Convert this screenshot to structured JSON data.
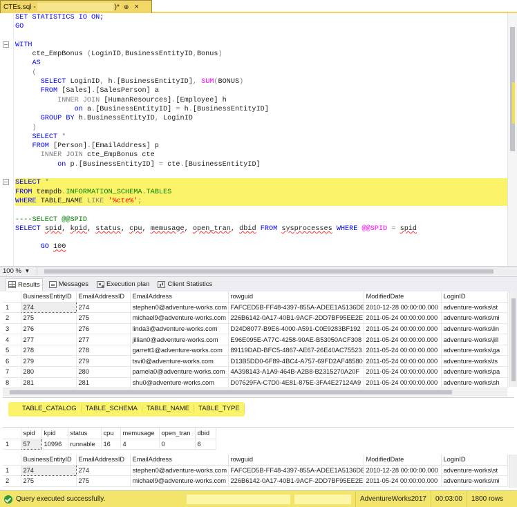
{
  "tab": {
    "title_prefix": "CTEs.sql - ",
    "title_suffix": ")*",
    "pin": "⊕",
    "close": "×"
  },
  "editor": {
    "lines": [
      [
        [
          "SET STATISTICS IO ON;",
          "kw"
        ]
      ],
      [
        [
          "GO",
          "kw"
        ]
      ],
      [
        [
          "",
          ""
        ]
      ],
      [
        [
          "WITH",
          "kw"
        ]
      ],
      [
        [
          "    cte_EmpBonus ",
          ""
        ],
        [
          "(",
          "gr"
        ],
        [
          "LoginID",
          ""
        ],
        [
          ",",
          "gr"
        ],
        [
          "BusinessEntityID",
          ""
        ],
        [
          ",",
          "gr"
        ],
        [
          "Bonus",
          ""
        ],
        [
          ")",
          "gr"
        ]
      ],
      [
        [
          "    ",
          ""
        ],
        [
          "AS",
          "kw"
        ]
      ],
      [
        [
          "    ",
          ""
        ],
        [
          "(",
          "gr"
        ]
      ],
      [
        [
          "      ",
          ""
        ],
        [
          "SELECT",
          "kw"
        ],
        [
          " LoginID",
          ""
        ],
        [
          ",",
          "gr"
        ],
        [
          " h",
          ""
        ],
        [
          ".",
          "gr"
        ],
        [
          "[BusinessEntityID]",
          ""
        ],
        [
          ",",
          "gr"
        ],
        [
          " ",
          ""
        ],
        [
          "SUM",
          "pk"
        ],
        [
          "(",
          "gr"
        ],
        [
          "BONUS",
          ""
        ],
        [
          ")",
          "gr"
        ]
      ],
      [
        [
          "      ",
          ""
        ],
        [
          "FROM",
          "kw"
        ],
        [
          " [Sales]",
          ""
        ],
        [
          ".",
          "gr"
        ],
        [
          "[SalesPerson] a",
          ""
        ]
      ],
      [
        [
          "          ",
          ""
        ],
        [
          "INNER JOIN",
          "gr"
        ],
        [
          " [HumanResources]",
          ""
        ],
        [
          ".",
          "gr"
        ],
        [
          "[Employee] h",
          ""
        ]
      ],
      [
        [
          "              ",
          ""
        ],
        [
          "on",
          "kw"
        ],
        [
          " a",
          ""
        ],
        [
          ".",
          "gr"
        ],
        [
          "[BusinessEntityID] ",
          ""
        ],
        [
          "=",
          "gr"
        ],
        [
          " h",
          ""
        ],
        [
          ".",
          "gr"
        ],
        [
          "[BusinessEntityID]",
          ""
        ]
      ],
      [
        [
          "      ",
          ""
        ],
        [
          "GROUP BY",
          "kw"
        ],
        [
          " h",
          ""
        ],
        [
          ".",
          "gr"
        ],
        [
          "BusinessEntityID",
          ""
        ],
        [
          ",",
          "gr"
        ],
        [
          " LoginID",
          ""
        ]
      ],
      [
        [
          "    ",
          ""
        ],
        [
          ")",
          "gr"
        ]
      ],
      [
        [
          "    ",
          ""
        ],
        [
          "SELECT",
          "kw"
        ],
        [
          " ",
          ""
        ],
        [
          "*",
          "gr"
        ]
      ],
      [
        [
          "    ",
          ""
        ],
        [
          "FROM",
          "kw"
        ],
        [
          " [Person]",
          ""
        ],
        [
          ".",
          "gr"
        ],
        [
          "[EmailAddress] p",
          ""
        ]
      ],
      [
        [
          "      ",
          ""
        ],
        [
          "INNER JOIN",
          "gr"
        ],
        [
          " cte_EmpBonus cte",
          ""
        ]
      ],
      [
        [
          "          ",
          ""
        ],
        [
          "on",
          "kw"
        ],
        [
          " p",
          ""
        ],
        [
          ".",
          "gr"
        ],
        [
          "[BusinessEntityID] ",
          ""
        ],
        [
          "=",
          "gr"
        ],
        [
          " cte",
          ""
        ],
        [
          ".",
          "gr"
        ],
        [
          "[BusinessEntityID]",
          ""
        ]
      ],
      [
        [
          "",
          ""
        ]
      ],
      [
        [
          "SELECT",
          "kw"
        ],
        [
          " ",
          ""
        ],
        [
          "*",
          "gr"
        ]
      ],
      [
        [
          "FROM",
          "kw"
        ],
        [
          " tempdb",
          ""
        ],
        [
          ".",
          "gr"
        ],
        [
          "INFORMATION_SCHEMA",
          "gn"
        ],
        [
          ".",
          "gr"
        ],
        [
          "TABLES",
          "gn"
        ]
      ],
      [
        [
          "WHERE",
          "kw"
        ],
        [
          " TABLE_NAME ",
          ""
        ],
        [
          "LIKE",
          "gr"
        ],
        [
          " ",
          ""
        ],
        [
          "'%cte%'",
          "st"
        ],
        [
          ";",
          "gr"
        ]
      ],
      [
        [
          "",
          ""
        ]
      ],
      [
        [
          "----SELECT @@SPID",
          "gn"
        ]
      ],
      [
        [
          "SELECT",
          "kw"
        ],
        [
          " ",
          ""
        ],
        [
          "spid",
          "wv"
        ],
        [
          ", ",
          ""
        ],
        [
          "kpid",
          "wv"
        ],
        [
          ", ",
          ""
        ],
        [
          "status",
          "wv"
        ],
        [
          ", ",
          ""
        ],
        [
          "cpu",
          "wv"
        ],
        [
          ", ",
          ""
        ],
        [
          "memusage",
          "wv"
        ],
        [
          ", ",
          ""
        ],
        [
          "open_tran",
          "wv"
        ],
        [
          ", ",
          ""
        ],
        [
          "dbid",
          "wv"
        ],
        [
          " ",
          ""
        ],
        [
          "FROM",
          "kw"
        ],
        [
          " ",
          ""
        ],
        [
          "sysprocesses",
          "wv"
        ],
        [
          " ",
          ""
        ],
        [
          "WHERE",
          "kw"
        ],
        [
          " ",
          ""
        ],
        [
          "@@SPID",
          "pk"
        ],
        [
          " ",
          ""
        ],
        [
          "=",
          "gr"
        ],
        [
          " ",
          ""
        ],
        [
          "spid",
          "wv"
        ]
      ],
      [
        [
          "",
          ""
        ]
      ],
      [
        [
          "      ",
          ""
        ],
        [
          "GO",
          "kw"
        ],
        [
          " ",
          ""
        ],
        [
          "100",
          "wv"
        ]
      ]
    ]
  },
  "zoom": {
    "value": "100 %",
    "arrow": "▾"
  },
  "result_tabs": [
    {
      "label": "Results",
      "icon": "grid-icon"
    },
    {
      "label": "Messages",
      "icon": "messages-icon"
    },
    {
      "label": "Execution plan",
      "icon": "execution-plan-icon"
    },
    {
      "label": "Client Statistics",
      "icon": "client-statistics-icon"
    }
  ],
  "grid1": {
    "columns": [
      "",
      "BusinessEntityID",
      "EmailAddressID",
      "EmailAddress",
      "rowguid",
      "ModifiedDate",
      "LoginID"
    ],
    "rows": [
      [
        "1",
        "274",
        "274",
        "stephen0@adventure-works.com",
        "FAFCED5B-FF48-4397-855A-ADEE1A5136DE",
        "2010-12-28 00:00:00.000",
        "adventure-works\\st"
      ],
      [
        "2",
        "275",
        "275",
        "michael9@adventure-works.com",
        "226B6142-0A17-40B1-9ACF-2DD7BF95EE2E",
        "2011-05-24 00:00:00.000",
        "adventure-works\\mi"
      ],
      [
        "3",
        "276",
        "276",
        "linda3@adventure-works.com",
        "D24D8077-B9E6-4000-A591-C0E9283BF192",
        "2011-05-24 00:00:00.000",
        "adventure-works\\lin"
      ],
      [
        "4",
        "277",
        "277",
        "jillian0@adventure-works.com",
        "E96E095E-A77C-4258-90AE-B53050ACF308",
        "2011-05-24 00:00:00.000",
        "adventure-works\\jill"
      ],
      [
        "5",
        "278",
        "278",
        "garrett1@adventure-works.com",
        "89119DAD-BFC5-4867-AE67-26E40AC75523",
        "2011-05-24 00:00:00.000",
        "adventure-works\\ga"
      ],
      [
        "6",
        "279",
        "279",
        "tsvi0@adventure-works.com",
        "D13B5DD0-6F89-4BC4-A757-69FD2AF48580",
        "2011-05-24 00:00:00.000",
        "adventure-works\\ts"
      ],
      [
        "7",
        "280",
        "280",
        "pamela0@adventure-works.com",
        "4A398143-A1A9-464B-A2B8-B2315270A20F",
        "2011-05-24 00:00:00.000",
        "adventure-works\\pa"
      ],
      [
        "8",
        "281",
        "281",
        "shu0@adventure-works.com",
        "D07629FA-C7D0-4E81-875E-3FA4E27124A9",
        "2011-05-24 00:00:00.000",
        "adventure-works\\sh"
      ]
    ]
  },
  "grid2": {
    "columns": [
      "TABLE_CATALOG",
      "TABLE_SCHEMA",
      "TABLE_NAME",
      "TABLE_TYPE"
    ]
  },
  "grid3": {
    "columns": [
      "",
      "spid",
      "kpid",
      "status",
      "cpu",
      "memusage",
      "open_tran",
      "dbid"
    ],
    "rows": [
      [
        "1",
        "57",
        "10996",
        "runnable",
        "16",
        "4",
        "0",
        "6"
      ]
    ]
  },
  "grid4": {
    "columns": [
      "",
      "BusinessEntityID",
      "EmailAddressID",
      "EmailAddress",
      "rowguid",
      "ModifiedDate",
      "LoginID"
    ],
    "rows": [
      [
        "1",
        "274",
        "274",
        "stephen0@adventure-works.com",
        "FAFCED5B-FF48-4397-855A-ADEE1A5136DE",
        "2010-12-28 00:00:00.000",
        "adventure-works\\st"
      ],
      [
        "2",
        "275",
        "275",
        "michael9@adventure-works.com",
        "226B6142-0A17-40B1-9ACF-2DD7BF95EE2E",
        "2011-05-24 00:00:00.000",
        "adventure-works\\mi"
      ]
    ]
  },
  "status": {
    "message": "Query executed successfully.",
    "database": "AdventureWorks2017",
    "elapsed": "00:03:00",
    "rows": "1800 rows"
  },
  "colors": {
    "highlight": "#fbf36a",
    "keyword": "#0000ff",
    "status_bar": "#f3e46b",
    "success": "#2f9a2f"
  }
}
